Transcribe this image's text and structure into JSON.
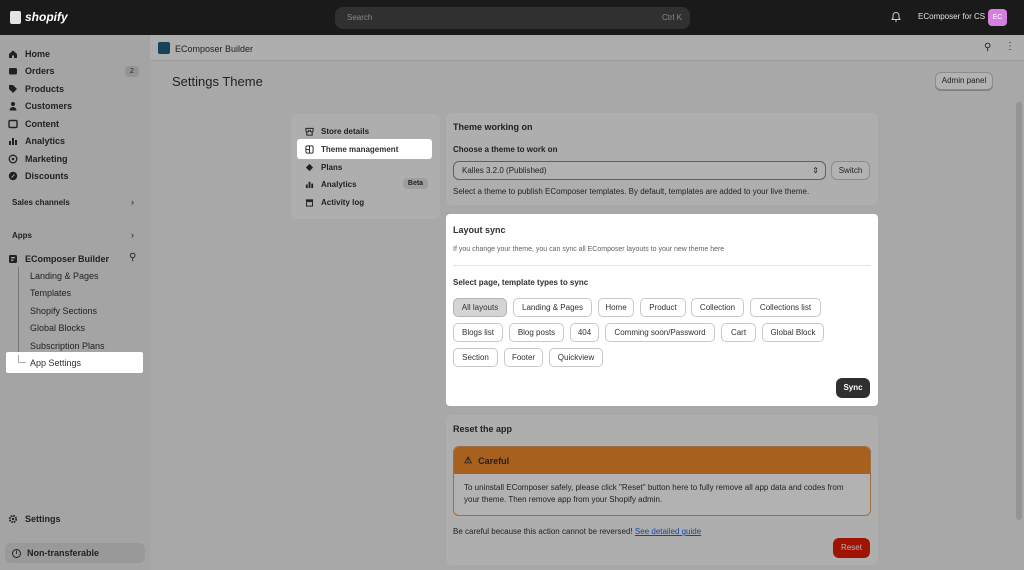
{
  "topbar": {
    "brand": "shopify",
    "search_placeholder": "Search",
    "search_shortcut": "Ctrl K",
    "store_name": "EComposer for CS",
    "avatar_initials": "EC"
  },
  "sidebar": {
    "nav": [
      {
        "label": "Home",
        "icon": "home-icon"
      },
      {
        "label": "Orders",
        "icon": "orders-icon",
        "badge": "2"
      },
      {
        "label": "Products",
        "icon": "tag-icon"
      },
      {
        "label": "Customers",
        "icon": "person-icon"
      },
      {
        "label": "Content",
        "icon": "content-icon"
      },
      {
        "label": "Analytics",
        "icon": "chart-icon"
      },
      {
        "label": "Marketing",
        "icon": "target-icon"
      },
      {
        "label": "Discounts",
        "icon": "discount-icon"
      }
    ],
    "sales_channels": "Sales channels",
    "apps": "Apps",
    "app_name": "EComposer Builder",
    "app_sub": [
      "Landing & Pages",
      "Templates",
      "Shopify Sections",
      "Global Blocks",
      "Subscription Plans",
      "App Settings"
    ],
    "settings": "Settings",
    "non_transferable": "Non-transferable"
  },
  "appbar": {
    "title": "EComposer Builder"
  },
  "page": {
    "title": "Settings Theme",
    "admin_panel": "Admin panel"
  },
  "menu": {
    "items": [
      "Store details",
      "Theme management",
      "Plans",
      "Analytics",
      "Activity log"
    ],
    "beta": "Beta"
  },
  "theme_card": {
    "title": "Theme working on",
    "choose_label": "Choose a theme to work on",
    "selected": "Kalles 3.2.0 (Published)",
    "switch": "Switch",
    "help": "Select a theme to publish EComposer templates. By default, templates are added to your live theme."
  },
  "layout_sync": {
    "title": "Layout sync",
    "description": "If you change your theme, you can sync all EComposer layouts to your new theme here",
    "select_label": "Select page, template types to sync",
    "chips": [
      "All layouts",
      "Landing & Pages",
      "Home",
      "Product",
      "Collection",
      "Collections list",
      "Blogs list",
      "Blog posts",
      "404",
      "Comming soon/Password",
      "Cart",
      "Global Block",
      "Section",
      "Footer",
      "Quickview"
    ],
    "selected_chip": "All layouts",
    "sync": "Sync"
  },
  "reset": {
    "title": "Reset the app",
    "banner_title": "Careful",
    "banner_text": "To uninstall EComposer safely, please click \"Reset\" button here to fully remove all app data and codes from your theme. Then remove app from your Shopify admin.",
    "warning": "Be careful because this action cannot be reversed!",
    "guide_link": "See detailed guide",
    "button": "Reset"
  },
  "colors": {
    "topbar": "#1a1a1a",
    "accent_orange": "#f08a2a",
    "reset_red": "#e51c00",
    "link": "#2463eb"
  }
}
